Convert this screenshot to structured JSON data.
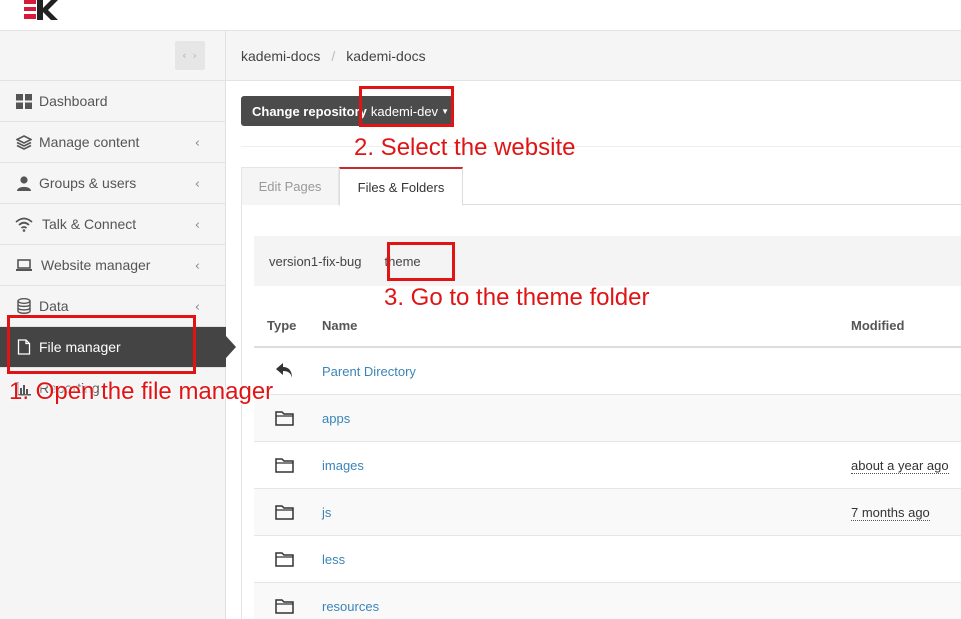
{
  "sidebar": {
    "items": [
      {
        "label": "Dashboard",
        "icon": "dashboard-icon",
        "chevron": false
      },
      {
        "label": "Manage content",
        "icon": "layers-icon",
        "chevron": true
      },
      {
        "label": "Groups & users",
        "icon": "user-icon",
        "chevron": true
      },
      {
        "label": "Talk & Connect",
        "icon": "wifi-icon",
        "chevron": true
      },
      {
        "label": "Website manager",
        "icon": "laptop-icon",
        "chevron": true
      },
      {
        "label": "Data",
        "icon": "database-icon",
        "chevron": true
      },
      {
        "label": "File manager",
        "icon": "file-icon",
        "chevron": false,
        "active": true
      },
      {
        "label": "Reporting",
        "icon": "bar-chart-icon",
        "chevron": false
      }
    ]
  },
  "breadcrumb": [
    "kademi-docs",
    "kademi-docs"
  ],
  "repo": {
    "label": "Change repository",
    "value": "kademi-dev"
  },
  "tabs": [
    "Edit Pages",
    "Files & Folders"
  ],
  "path": [
    "version1-fix-bug",
    "theme"
  ],
  "table": {
    "headers": {
      "type": "Type",
      "name": "Name",
      "modified": "Modified"
    },
    "rows": [
      {
        "icon": "back-arrow-icon",
        "name": "Parent Directory",
        "modified": ""
      },
      {
        "icon": "folder-icon",
        "name": "apps",
        "modified": ""
      },
      {
        "icon": "folder-icon",
        "name": "images",
        "modified": "about a year ago"
      },
      {
        "icon": "folder-icon",
        "name": "js",
        "modified": "7 months ago"
      },
      {
        "icon": "folder-icon",
        "name": "less",
        "modified": ""
      },
      {
        "icon": "folder-icon",
        "name": "resources",
        "modified": ""
      }
    ]
  },
  "annotations": {
    "step1": "1. Open the file manager",
    "step2": "2. Select the website",
    "step3": "3. Go to the theme folder"
  },
  "colors": {
    "accent": "#c72b2b",
    "annotation": "#e01414",
    "link": "#3b84b8",
    "sidebar_active": "#444444"
  }
}
